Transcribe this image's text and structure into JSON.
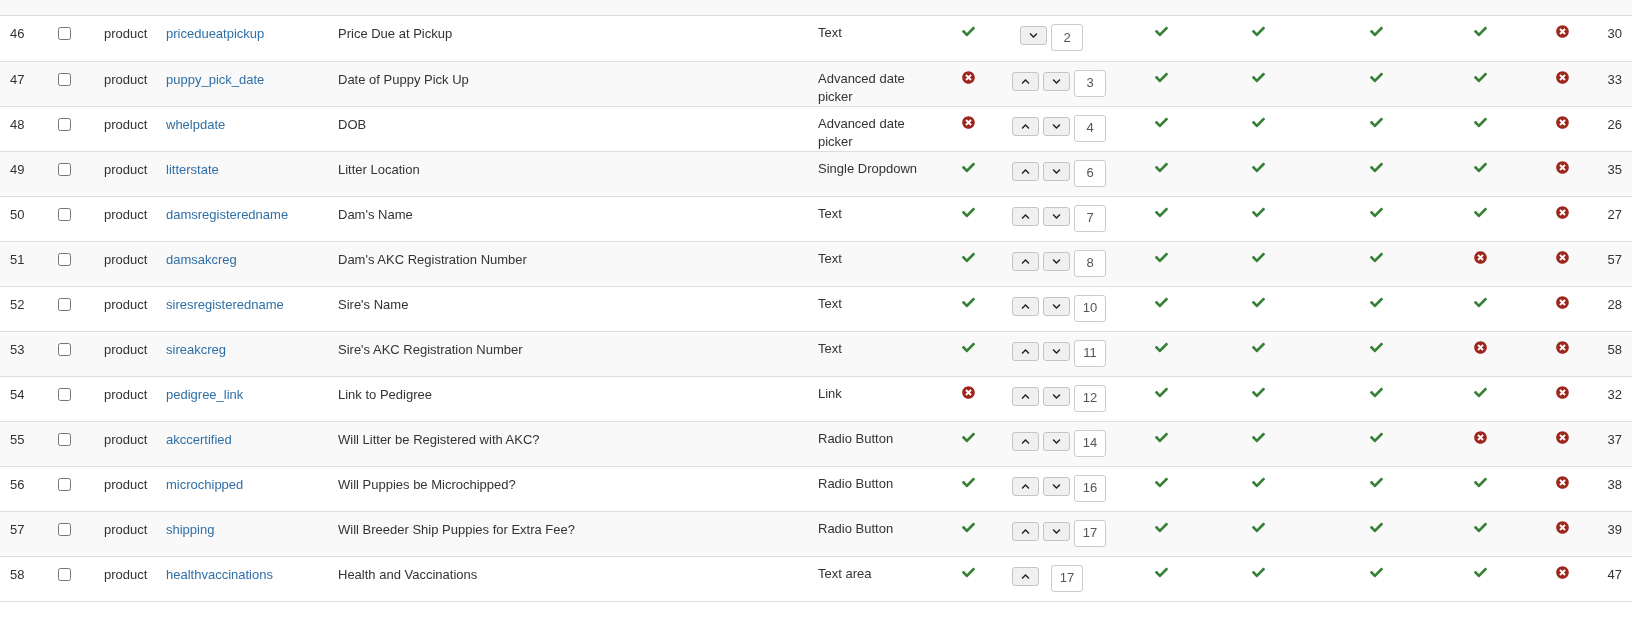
{
  "rows": [
    {
      "id": "46",
      "checked": false,
      "section": "product",
      "name": "pricedueatpickup",
      "label": "Price Due at Pickup",
      "type": "Text",
      "checks": [
        true,
        true,
        true,
        true,
        true,
        false
      ],
      "order": {
        "up": false,
        "down": true,
        "value": "2"
      },
      "count": "30"
    },
    {
      "id": "47",
      "checked": false,
      "section": "product",
      "name": "puppy_pick_date",
      "label": "Date of Puppy Pick Up",
      "type": "Advanced date picker",
      "checks": [
        false,
        true,
        true,
        true,
        true,
        false
      ],
      "order": {
        "up": true,
        "down": true,
        "value": "3"
      },
      "count": "33"
    },
    {
      "id": "48",
      "checked": false,
      "section": "product",
      "name": "whelpdate",
      "label": "DOB",
      "type": "Advanced date picker",
      "checks": [
        false,
        true,
        true,
        true,
        true,
        false
      ],
      "order": {
        "up": true,
        "down": true,
        "value": "4"
      },
      "count": "26"
    },
    {
      "id": "49",
      "checked": false,
      "section": "product",
      "name": "litterstate",
      "label": "Litter Location",
      "type": "Single Dropdown",
      "checks": [
        true,
        true,
        true,
        true,
        true,
        false
      ],
      "order": {
        "up": true,
        "down": true,
        "value": "6"
      },
      "count": "35"
    },
    {
      "id": "50",
      "checked": false,
      "section": "product",
      "name": "damsregisteredname",
      "label": "Dam's Name",
      "type": "Text",
      "checks": [
        true,
        true,
        true,
        true,
        true,
        false
      ],
      "order": {
        "up": true,
        "down": true,
        "value": "7"
      },
      "count": "27"
    },
    {
      "id": "51",
      "checked": false,
      "section": "product",
      "name": "damsakcreg",
      "label": "Dam's AKC Registration Number",
      "type": "Text",
      "checks": [
        true,
        true,
        true,
        true,
        false,
        false
      ],
      "order": {
        "up": true,
        "down": true,
        "value": "8"
      },
      "count": "57"
    },
    {
      "id": "52",
      "checked": false,
      "section": "product",
      "name": "siresregisteredname",
      "label": "Sire's Name",
      "type": "Text",
      "checks": [
        true,
        true,
        true,
        true,
        true,
        false
      ],
      "order": {
        "up": true,
        "down": true,
        "value": "10"
      },
      "count": "28"
    },
    {
      "id": "53",
      "checked": false,
      "section": "product",
      "name": "sireakcreg",
      "label": "Sire's AKC Registration Number",
      "type": "Text",
      "checks": [
        true,
        true,
        true,
        true,
        false,
        false
      ],
      "order": {
        "up": true,
        "down": true,
        "value": "11"
      },
      "count": "58"
    },
    {
      "id": "54",
      "checked": false,
      "section": "product",
      "name": "pedigree_link",
      "label": "Link to Pedigree",
      "type": "Link",
      "checks": [
        false,
        true,
        true,
        true,
        true,
        false
      ],
      "order": {
        "up": true,
        "down": true,
        "value": "12"
      },
      "count": "32"
    },
    {
      "id": "55",
      "checked": false,
      "section": "product",
      "name": "akccertified",
      "label": "Will Litter be Registered with AKC?",
      "type": "Radio Button",
      "checks": [
        true,
        true,
        true,
        true,
        false,
        false
      ],
      "order": {
        "up": true,
        "down": true,
        "value": "14"
      },
      "count": "37"
    },
    {
      "id": "56",
      "checked": false,
      "section": "product",
      "name": "microchipped",
      "label": "Will Puppies be Microchipped?",
      "type": "Radio Button",
      "checks": [
        true,
        true,
        true,
        true,
        true,
        false
      ],
      "order": {
        "up": true,
        "down": true,
        "value": "16"
      },
      "count": "38"
    },
    {
      "id": "57",
      "checked": false,
      "section": "product",
      "name": "shipping",
      "label": "Will Breeder Ship Puppies for Extra Fee?",
      "type": "Radio Button",
      "checks": [
        true,
        true,
        true,
        true,
        true,
        false
      ],
      "order": {
        "up": true,
        "down": true,
        "value": "17"
      },
      "count": "39"
    },
    {
      "id": "58",
      "checked": false,
      "section": "product",
      "name": "healthvaccinations",
      "label": "Health and Vaccinations",
      "type": "Text area",
      "checks": [
        true,
        true,
        true,
        true,
        true,
        false
      ],
      "order": {
        "up": true,
        "down": false,
        "value": "17"
      },
      "count": "47"
    }
  ]
}
